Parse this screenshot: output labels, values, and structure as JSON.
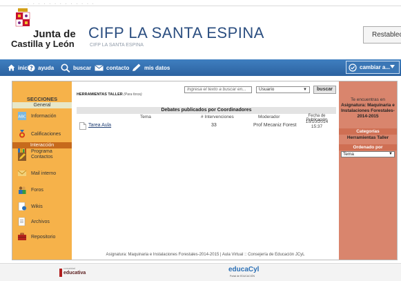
{
  "header": {
    "logo_line1": "Junta de",
    "logo_line2": "Castilla y León",
    "site_title": "CIFP LA SANTA ESPINA",
    "site_subtitle": "CIFP LA SANTA ESPINA",
    "restablecer_label": "Restablecer"
  },
  "nav": {
    "inicio": "inicio",
    "ayuda": "ayuda",
    "buscar": "buscar",
    "contacto": "contacto",
    "mis_datos": "mis datos",
    "cambiar": "cambiar a..."
  },
  "sidebar": {
    "heading": "SECCIONES",
    "group_general": "General",
    "group_interaccion": "Interacción",
    "items": [
      {
        "label": "Información",
        "icon": "info-icon"
      },
      {
        "label": "Calificaciones",
        "icon": "medal-icon"
      },
      {
        "label": "Programa",
        "icon": "books-icon"
      },
      {
        "label": "Contactos",
        "icon": "pencil-icon"
      },
      {
        "label": "Mail interno",
        "icon": "mail-icon"
      },
      {
        "label": "Foros",
        "icon": "people-icon"
      },
      {
        "label": "Wikis",
        "icon": "wiki-icon"
      },
      {
        "label": "Archivos",
        "icon": "folder-icon"
      },
      {
        "label": "Repositorio",
        "icon": "briefcase-icon"
      }
    ]
  },
  "content": {
    "breadcrumb_bold": "HERRAMIENTAS TALLER",
    "breadcrumb_italic": "(Para foros)",
    "search_placeholder": "Ingresa el texto a buscar en...",
    "search_scope": "Usuario",
    "search_button": "buscar",
    "table_title": "Debates publicados por Coordinadores",
    "columns": {
      "tema": "Tema",
      "intervenciones": "# Intervenciones",
      "moderador": "Moderador",
      "fecha_line1": "Fecha de",
      "fecha_line2": "Publicación"
    },
    "rows": [
      {
        "tema": "Tarea Aula",
        "intervenciones": "33",
        "moderador": "Prof Mecaniz Forest",
        "fecha_line1": "15/10/2014",
        "fecha_line2": "15:37"
      }
    ],
    "footer_text": "Asignatura: Maquinaria e Instalaciones Forestales-2014-2015 | Aula Virtual :: Consejería de Educación JCyL"
  },
  "right_panel": {
    "te_encuentras": "Te encuentras en",
    "course_lines": [
      "Asignatura: Maquinaria e",
      "Instalaciones Forestales-",
      "2014-2015"
    ],
    "categorias_heading": "Categorías",
    "categoria_value": "Herramientas Taller",
    "ordenado_heading": "Ordenado por",
    "ordenado_value": "Tema"
  },
  "footer": {
    "educativa_small": "comunidad",
    "educativa_label": "educativa",
    "educacyl_label": "educaCyl",
    "educacyl_sub": "Portal de EDUCACIÓN"
  },
  "colors": {
    "nav_blue": "#2c62a0",
    "sidebar_orange": "#f6b24a",
    "right_panel_salmon": "#d9856d",
    "title_blue": "#2b4e80"
  }
}
